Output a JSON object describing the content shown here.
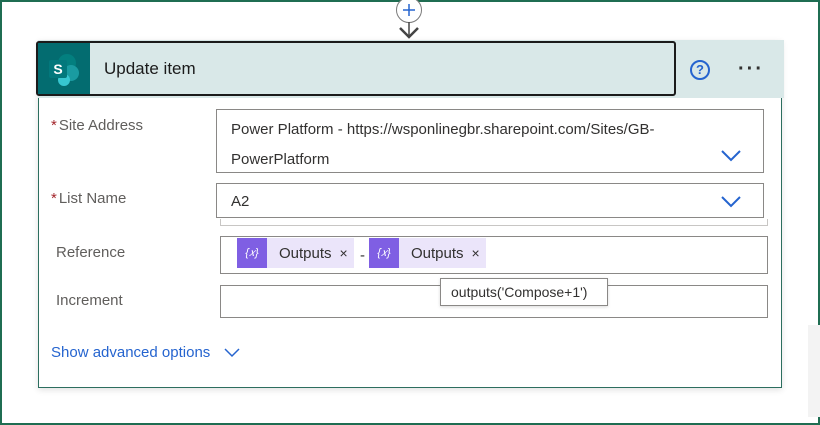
{
  "connector": {
    "add_icon": "plus-icon",
    "arrow_icon": "arrow-down-icon"
  },
  "action": {
    "title": "Update item",
    "icon": "sharepoint-icon",
    "help_icon": "help-circle-icon",
    "help_glyph": "?",
    "more_icon": "ellipsis-icon",
    "more_glyph": "···"
  },
  "fields": {
    "site_address": {
      "required_mark": "*",
      "label": "Site Address",
      "value_line1": "Power Platform - https://wsponlinegbr.sharepoint.com/Sites/GB-",
      "value_line2": "PowerPlatform"
    },
    "list_name": {
      "required_mark": "*",
      "label": "List Name",
      "value": "A2"
    },
    "reference": {
      "label": "Reference",
      "tokens": [
        {
          "icon_glyph": "{𝑥}",
          "text": "Outputs",
          "remove": "×"
        },
        {
          "icon_glyph": "{𝑥}",
          "text": "Outputs",
          "remove": "×"
        }
      ],
      "separator": "-"
    },
    "increment": {
      "label": "Increment",
      "value": ""
    }
  },
  "tooltip": "outputs('Compose+1')",
  "advanced": {
    "label": "Show advanced options",
    "icon": "chevron-down-icon"
  },
  "colors": {
    "accent": "#2564cf",
    "header_bg": "#d9e8e8",
    "sharepoint": "#036c70",
    "token": "#7f5fe3"
  }
}
